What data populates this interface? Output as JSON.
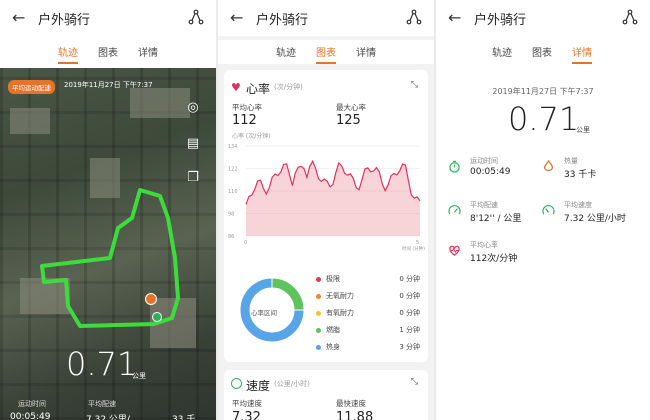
{
  "app": {
    "title": "户外骑行"
  },
  "tabs": [
    {
      "label": "轨迹"
    },
    {
      "label": "图表"
    },
    {
      "label": "详情"
    }
  ],
  "map": {
    "badge": "平均运动配速",
    "date": "2019年11月27日 下午7:37",
    "distance": "0.71",
    "distance_unit": "公里",
    "footer": {
      "label_time": "运动时间",
      "label_pace": "平均配速",
      "value_time": "00:05:49",
      "value_pace": "7.32 公里/...",
      "value_heat": "33 千..."
    }
  },
  "charts": {
    "heart": {
      "title": "心率",
      "unit": "(次/分钟)",
      "avg_label": "平均心率",
      "avg_value": "112",
      "avg_unit": "心率 (次/分钟)",
      "max_label": "最大心率",
      "max_value": "125",
      "y_ticks": [
        "134",
        "122",
        "110",
        "98",
        "86"
      ],
      "x_start": "0",
      "x_end": "5",
      "x_label": "时间 (分钟)",
      "zones_center": "心率区间",
      "zones": [
        {
          "name": "极限",
          "value": "0 分钟",
          "color": "#e53b3b"
        },
        {
          "name": "无氧耐力",
          "value": "0 分钟",
          "color": "#f0813d"
        },
        {
          "name": "有氧耐力",
          "value": "0 分钟",
          "color": "#f4c430"
        },
        {
          "name": "燃脂",
          "value": "1 分钟",
          "color": "#5dc35d"
        },
        {
          "name": "热身",
          "value": "3 分钟",
          "color": "#57a4e6"
        }
      ],
      "zones_values": [
        0,
        0,
        0,
        1,
        3
      ]
    },
    "speed": {
      "title": "速度",
      "unit": "(公里/小时)",
      "avg_label": "平均速度",
      "max_label": "最快速度",
      "avg_value": "7.32",
      "max_value": "11.88"
    }
  },
  "detail": {
    "date": "2019年11月27日 下午7:37",
    "distance": "0.71",
    "distance_unit": "公里",
    "stats": [
      {
        "label": "运动时间",
        "value": "00:05:49",
        "icon": "stopwatch-icon"
      },
      {
        "label": "热量",
        "value": "33 千卡",
        "icon": "flame-icon"
      },
      {
        "label": "平均配速",
        "value": "8'12'' / 公里",
        "icon": "pace-gauge-icon"
      },
      {
        "label": "平均速度",
        "value": "7.32 公里/小时",
        "icon": "speed-gauge-icon"
      },
      {
        "label": "平均心率",
        "value": "112次/分钟",
        "icon": "heart-rate-icon"
      }
    ]
  },
  "colors": {
    "accent": "#e6732a",
    "route": "#3ddc3d",
    "heart": "#e0325d",
    "stat_icon": "#2fb15a"
  }
}
